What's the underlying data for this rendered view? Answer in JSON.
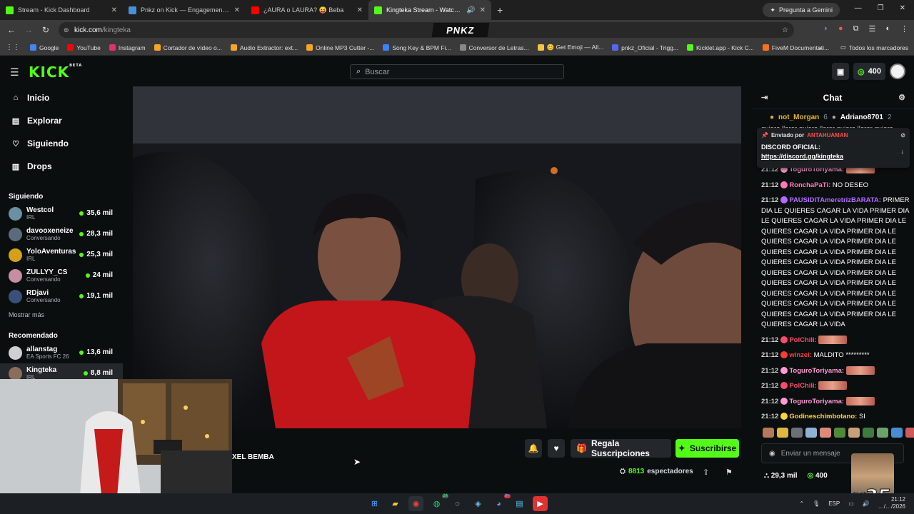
{
  "browser": {
    "tabs": [
      {
        "title": "Stream - Kick Dashboard",
        "color": "#53fc18"
      },
      {
        "title": "Pnkz on Kick — Engagement A",
        "color": "#4a90d9"
      },
      {
        "title": "¿AURA o LAURA? 😝 Beba",
        "color": "#ff0000"
      },
      {
        "title": "Kingteka Stream - Watch L",
        "color": "#53fc18"
      }
    ],
    "gemini_label": "Pregunta a Gemini",
    "url_host": "kick.com",
    "url_path": "/kingteka",
    "overlay_logo": "PNKZ",
    "bookmarks": [
      {
        "label": "Google",
        "color": "#4285f4"
      },
      {
        "label": "YouTube",
        "color": "#ff0000"
      },
      {
        "label": "Instagram",
        "color": "#e1306c"
      },
      {
        "label": "Cortador de vídeo o...",
        "color": "#f5a623"
      },
      {
        "label": "Audio Extractor: ext...",
        "color": "#f5a623"
      },
      {
        "label": "Online MP3 Cutter -...",
        "color": "#f5a623"
      },
      {
        "label": "Song Key & BPM Fi...",
        "color": "#3b82f6"
      },
      {
        "label": "Conversor de Letras...",
        "color": "#888888"
      },
      {
        "label": "😊 Get Emoji — All...",
        "color": "#f5c542"
      },
      {
        "label": "pnkz_Oficial - Trigg...",
        "color": "#5865f2"
      },
      {
        "label": "Kicklet.app - Kick C...",
        "color": "#53fc18"
      },
      {
        "label": "FiveM Documentati...",
        "color": "#f97316"
      }
    ],
    "all_bookmarks": "Todos los marcadores"
  },
  "kick": {
    "search_placeholder": "Buscar",
    "coins": "400",
    "nav": [
      {
        "label": "Inicio",
        "icon": "home-icon"
      },
      {
        "label": "Explorar",
        "icon": "compass-icon"
      },
      {
        "label": "Siguiendo",
        "icon": "heart-icon"
      },
      {
        "label": "Drops",
        "icon": "gift-icon"
      }
    ],
    "following_header": "Siguiendo",
    "following": [
      {
        "name": "Westcol",
        "category": "IRL",
        "viewers": "35,6 mil",
        "color": "#6b8fa3"
      },
      {
        "name": "davooxeneize",
        "category": "Conversando",
        "viewers": "28,3 mil",
        "color": "#5a6b7c"
      },
      {
        "name": "YoloAventuras",
        "category": "IRL",
        "viewers": "25,3 mil",
        "color": "#d4a017"
      },
      {
        "name": "ZULLYY_CS",
        "category": "Conversando",
        "viewers": "24 mil",
        "color": "#c78da3"
      },
      {
        "name": "RDjavi",
        "category": "Conversando",
        "viewers": "19,1 mil",
        "color": "#3a4f7a"
      }
    ],
    "show_more": "Mostrar más",
    "recommended_header": "Recomendado",
    "recommended": [
      {
        "name": "allanstag",
        "category": "EA Sports FC 26",
        "viewers": "13,6 mil",
        "color": "#d0d0d0"
      },
      {
        "name": "Kingteka",
        "category": "IRL",
        "viewers": "8,8 mil",
        "color": "#8a6d5a"
      }
    ],
    "streamer_name": "XEL BEMBA",
    "gift_label": "Regala Suscripciones",
    "subscribe_label": "Suscribirse",
    "viewer_count": "8813",
    "viewer_label": "espectadores"
  },
  "chat": {
    "title": "Chat",
    "leaders": [
      {
        "name": "not_Morgan",
        "count": "6"
      },
      {
        "name": "Adriano8701",
        "count": "2"
      }
    ],
    "scroll_text": "quiero llorar quiero llorar quiero llorar quiero",
    "pinned": {
      "sent_by_label": "Enviado por",
      "sender": "ANTAHUAMAN",
      "body": "DISCORD OFICIAL:",
      "link": "https://discord.gg/kingteka"
    },
    "messages": [
      {
        "time": "21:12",
        "user": "ToguroToriyama:",
        "color": "#ff9ad5",
        "text": "",
        "emote": true
      },
      {
        "time": "21:12",
        "user": "RonchaPaTi:",
        "color": "#ff7ab8",
        "text": "NO DESEO",
        "emote": false
      },
      {
        "time": "21:12",
        "user": "PAUSIDITAmeretrizBARATA:",
        "color": "#b36bff",
        "text": "PRIMER DIA LE QUIERES CAGAR LA VIDA PRIMER DIA LE QUIERES CAGAR LA VIDA PRIMER DIA LE QUIERES CAGAR LA VIDA PRIMER DIA LE QUIERES CAGAR LA VIDA PRIMER DIA LE QUIERES CAGAR LA VIDA PRIMER DIA LE QUIERES CAGAR LA VIDA PRIMER DIA LE QUIERES CAGAR LA VIDA PRIMER DIA LE QUIERES CAGAR LA VIDA PRIMER DIA LE QUIERES CAGAR LA VIDA PRIMER DIA LE QUIERES CAGAR LA VIDA PRIMER DIA LE QUIERES CAGAR LA VIDA PRIMER DIA LE QUIERES CAGAR LA VIDA",
        "emote": false
      },
      {
        "time": "21:12",
        "user": "PolChili:",
        "color": "#ff4c6a",
        "text": "",
        "emote": true
      },
      {
        "time": "21:12",
        "user": "winzei:",
        "color": "#ff3b3b",
        "text": "MALDITO *********",
        "emote": false
      },
      {
        "time": "21:12",
        "user": "ToguroToriyama:",
        "color": "#ff9ad5",
        "text": "",
        "emote": true
      },
      {
        "time": "21:12",
        "user": "PolChili:",
        "color": "#ff4c6a",
        "text": "",
        "emote": true
      },
      {
        "time": "21:12",
        "user": "ToguroToriyama:",
        "color": "#ff9ad5",
        "text": "",
        "emote": true
      },
      {
        "time": "21:12",
        "user": "Godineschimbotano:",
        "color": "#ffd23f",
        "text": "SI",
        "emote": false
      }
    ],
    "input_placeholder": "Enviar un mensaje",
    "followers": "29,3 mil",
    "coins": "400",
    "overlay_badge": "x35"
  },
  "taskbar": {
    "lang": "ESP",
    "time": "21:12",
    "date": "…/…/2026",
    "whatsapp_badge": "24",
    "discord_badge": "9+"
  },
  "colors": {
    "kick_green": "#53fc18",
    "bg": "#0b0e0f"
  }
}
